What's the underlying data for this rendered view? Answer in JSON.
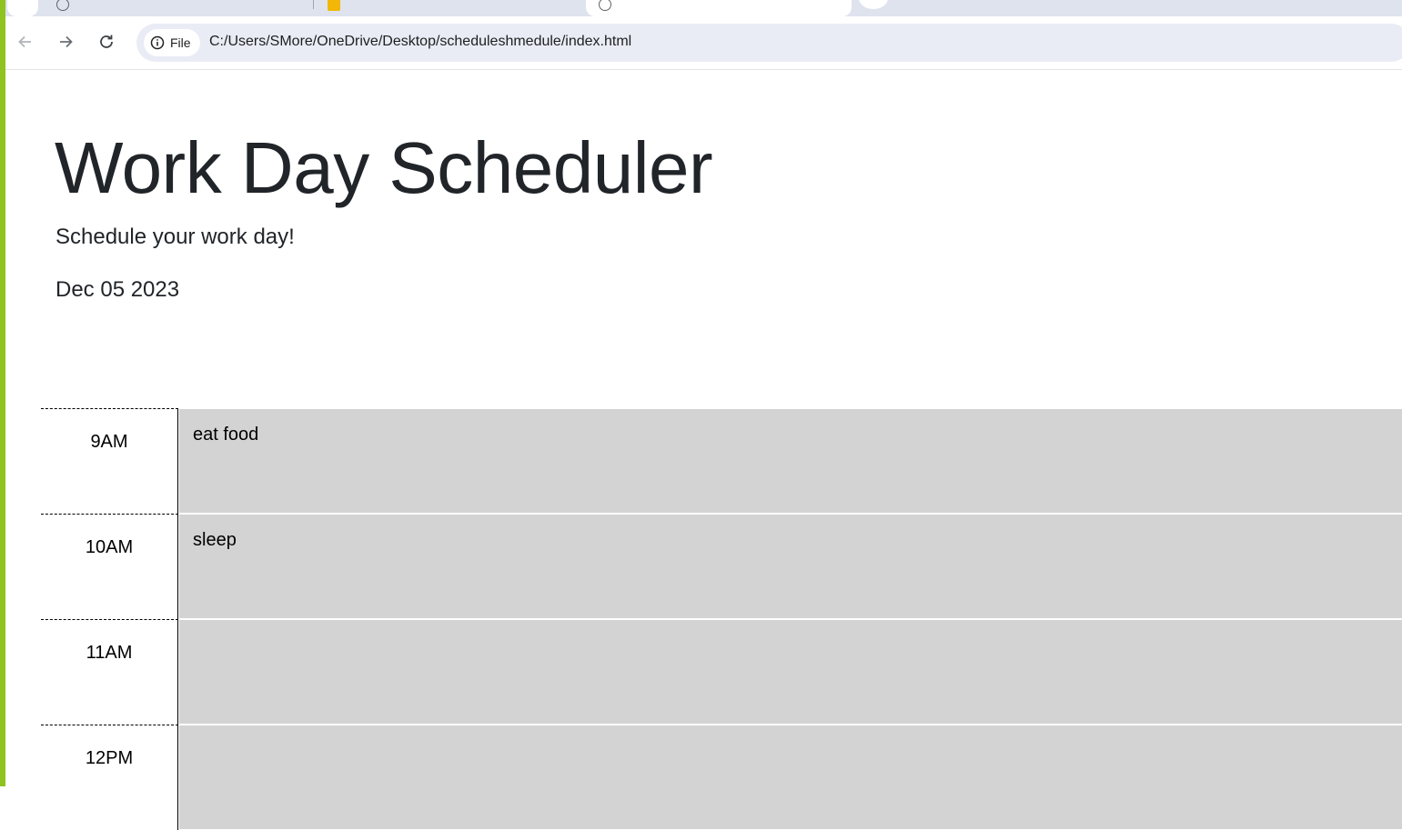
{
  "browser": {
    "address_chip_label": "File",
    "url": "C:/Users/SMore/OneDrive/Desktop/scheduleshmedule/index.html"
  },
  "header": {
    "title": "Work Day Scheduler",
    "subtitle": "Schedule your work day!",
    "current_day": "Dec 05 2023"
  },
  "schedule": {
    "rows": [
      {
        "hour": "9AM",
        "text": "eat food"
      },
      {
        "hour": "10AM",
        "text": "sleep"
      },
      {
        "hour": "11AM",
        "text": ""
      },
      {
        "hour": "12PM",
        "text": ""
      }
    ]
  },
  "colors": {
    "accent": "#8fc31f",
    "row_background": "#d3d3d3",
    "title_text": "#212529"
  }
}
